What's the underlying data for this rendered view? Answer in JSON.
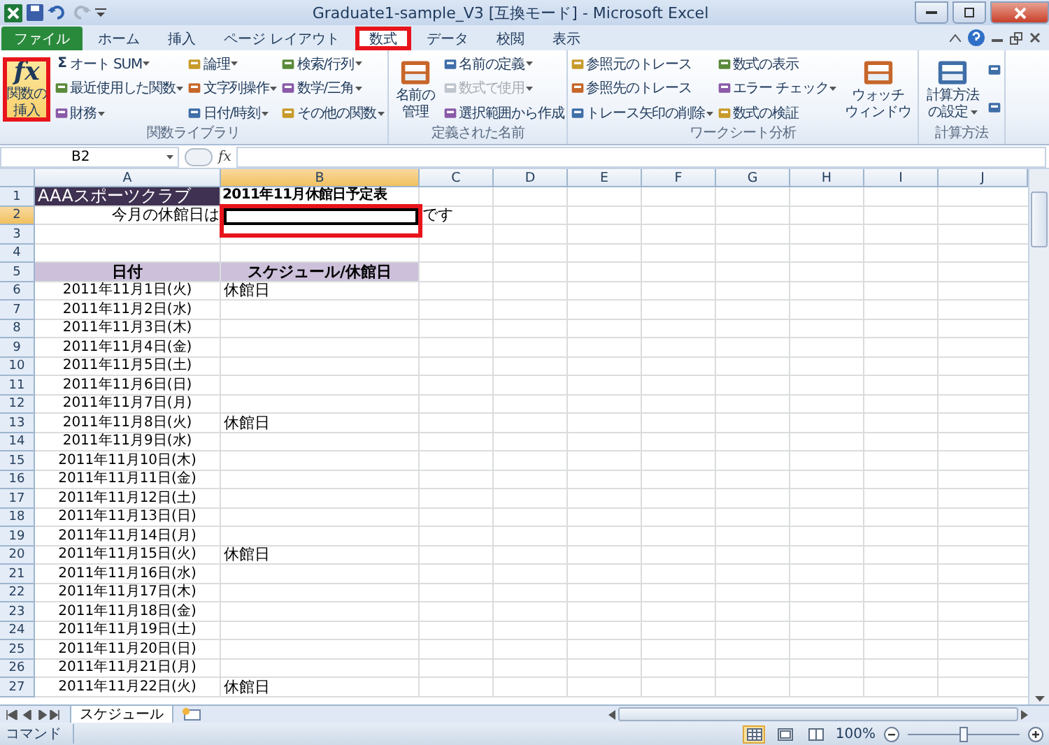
{
  "window": {
    "title": "Graduate1-sample_V3 [互換モード] - Microsoft Excel"
  },
  "tabs": [
    {
      "label": "ファイル",
      "kind": "file",
      "selected": false,
      "highlighted": false
    },
    {
      "label": "ホーム",
      "kind": "tab",
      "selected": false,
      "highlighted": false
    },
    {
      "label": "挿入",
      "kind": "tab",
      "selected": false,
      "highlighted": false
    },
    {
      "label": "ページ レイアウト",
      "kind": "tab",
      "selected": false,
      "highlighted": false
    },
    {
      "label": "数式",
      "kind": "tab",
      "selected": true,
      "highlighted": true
    },
    {
      "label": "データ",
      "kind": "tab",
      "selected": false,
      "highlighted": false
    },
    {
      "label": "校閲",
      "kind": "tab",
      "selected": false,
      "highlighted": false
    },
    {
      "label": "表示",
      "kind": "tab",
      "selected": false,
      "highlighted": false
    }
  ],
  "ribbon": {
    "groups": [
      {
        "label": "関数ライブラリ",
        "columns": [
          [
            {
              "kind": "large",
              "lines": [
                "関数の",
                "挿入"
              ],
              "glyph": "fx",
              "dropdown": false,
              "highlighted": true
            }
          ],
          [
            {
              "kind": "small",
              "label": "オート SUM",
              "glyph": "Σ",
              "dropdown": true,
              "disabled": false
            },
            {
              "kind": "small",
              "label": "最近使用した関数",
              "dropdown": true,
              "disabled": false
            },
            {
              "kind": "small",
              "label": "財務",
              "dropdown": true,
              "disabled": false
            }
          ],
          [
            {
              "kind": "small",
              "label": "論理",
              "dropdown": true,
              "disabled": false
            },
            {
              "kind": "small",
              "label": "文字列操作",
              "dropdown": true,
              "disabled": false
            },
            {
              "kind": "small",
              "label": "日付/時刻",
              "dropdown": true,
              "disabled": false
            }
          ],
          [
            {
              "kind": "small",
              "label": "検索/行列",
              "dropdown": true,
              "disabled": false
            },
            {
              "kind": "small",
              "label": "数学/三角",
              "dropdown": true,
              "disabled": false
            },
            {
              "kind": "small",
              "label": "その他の関数",
              "dropdown": true,
              "disabled": false
            }
          ]
        ]
      },
      {
        "label": "定義された名前",
        "columns": [
          [
            {
              "kind": "large",
              "lines": [
                "名前の",
                "管理"
              ],
              "dropdown": false,
              "highlighted": false
            }
          ],
          [
            {
              "kind": "small",
              "label": "名前の定義",
              "dropdown": true,
              "disabled": false
            },
            {
              "kind": "small",
              "label": "数式で使用",
              "dropdown": true,
              "disabled": true
            },
            {
              "kind": "small",
              "label": "選択範囲から作成",
              "dropdown": false,
              "disabled": false
            }
          ]
        ]
      },
      {
        "label": "ワークシート分析",
        "columns": [
          [
            {
              "kind": "small",
              "label": "参照元のトレース",
              "dropdown": false,
              "disabled": false
            },
            {
              "kind": "small",
              "label": "参照先のトレース",
              "dropdown": false,
              "disabled": false
            },
            {
              "kind": "small",
              "label": "トレース矢印の削除",
              "dropdown": true,
              "disabled": false
            }
          ],
          [
            {
              "kind": "small",
              "label": "数式の表示",
              "dropdown": false,
              "disabled": false
            },
            {
              "kind": "small",
              "label": "エラー チェック",
              "dropdown": true,
              "disabled": false
            },
            {
              "kind": "small",
              "label": "数式の検証",
              "dropdown": false,
              "disabled": false
            }
          ],
          [
            {
              "kind": "large",
              "lines": [
                "ウォッチ",
                "ウィンドウ"
              ],
              "dropdown": false,
              "highlighted": false
            }
          ]
        ]
      },
      {
        "label": "計算方法",
        "columns": [
          [
            {
              "kind": "large",
              "lines": [
                "計算方法",
                "の設定"
              ],
              "dropdown": true,
              "highlighted": false
            }
          ],
          [
            {
              "kind": "icon"
            },
            {
              "kind": "icon"
            }
          ]
        ]
      }
    ]
  },
  "formula_bar": {
    "name_box": "B2",
    "function_label": "fx"
  },
  "columns": [
    {
      "label": "A",
      "selected": false
    },
    {
      "label": "B",
      "selected": true
    },
    {
      "label": "C",
      "selected": false
    },
    {
      "label": "D",
      "selected": false
    },
    {
      "label": "E",
      "selected": false
    },
    {
      "label": "F",
      "selected": false
    },
    {
      "label": "G",
      "selected": false
    },
    {
      "label": "H",
      "selected": false
    },
    {
      "label": "I",
      "selected": false
    },
    {
      "label": "J",
      "selected": false
    }
  ],
  "rows": [
    {
      "header": "1",
      "selected": false,
      "cells": {
        "A": {
          "kind": "banner",
          "text": "AAAスポーツクラブ"
        },
        "B": {
          "kind": "title",
          "text": "2011年11月休館日予定表"
        }
      }
    },
    {
      "header": "2",
      "selected": true,
      "cells": {
        "A": {
          "kind": "label",
          "text": "今月の休館日は"
        },
        "B": {
          "kind": "input",
          "selected": true,
          "highlighted": true
        },
        "C": {
          "kind": "note",
          "text": "です"
        }
      }
    },
    {
      "header": "3",
      "selected": false
    },
    {
      "header": "4",
      "selected": false
    },
    {
      "header": "5",
      "selected": false,
      "cells": {
        "A": {
          "kind": "header",
          "text": "日付"
        },
        "B": {
          "kind": "header",
          "text": "スケジュール/休館日"
        }
      }
    },
    {
      "header": "6",
      "selected": false,
      "cells": {
        "A": {
          "kind": "date",
          "text": "2011年11月1日(火)"
        },
        "B": {
          "kind": "note",
          "text": "休館日"
        }
      }
    },
    {
      "header": "7",
      "selected": false,
      "cells": {
        "A": {
          "kind": "date",
          "text": "2011年11月2日(水)"
        }
      }
    },
    {
      "header": "8",
      "selected": false,
      "cells": {
        "A": {
          "kind": "date",
          "text": "2011年11月3日(木)"
        }
      }
    },
    {
      "header": "9",
      "selected": false,
      "cells": {
        "A": {
          "kind": "date",
          "text": "2011年11月4日(金)"
        }
      }
    },
    {
      "header": "10",
      "selected": false,
      "cells": {
        "A": {
          "kind": "date",
          "text": "2011年11月5日(土)"
        }
      }
    },
    {
      "header": "11",
      "selected": false,
      "cells": {
        "A": {
          "kind": "date",
          "text": "2011年11月6日(日)"
        }
      }
    },
    {
      "header": "12",
      "selected": false,
      "cells": {
        "A": {
          "kind": "date",
          "text": "2011年11月7日(月)"
        }
      }
    },
    {
      "header": "13",
      "selected": false,
      "cells": {
        "A": {
          "kind": "date",
          "text": "2011年11月8日(火)"
        },
        "B": {
          "kind": "note",
          "text": "休館日"
        }
      }
    },
    {
      "header": "14",
      "selected": false,
      "cells": {
        "A": {
          "kind": "date",
          "text": "2011年11月9日(水)"
        }
      }
    },
    {
      "header": "15",
      "selected": false,
      "cells": {
        "A": {
          "kind": "date",
          "text": "2011年11月10日(木)"
        }
      }
    },
    {
      "header": "16",
      "selected": false,
      "cells": {
        "A": {
          "kind": "date",
          "text": "2011年11月11日(金)"
        }
      }
    },
    {
      "header": "17",
      "selected": false,
      "cells": {
        "A": {
          "kind": "date",
          "text": "2011年11月12日(土)"
        }
      }
    },
    {
      "header": "18",
      "selected": false,
      "cells": {
        "A": {
          "kind": "date",
          "text": "2011年11月13日(日)"
        }
      }
    },
    {
      "header": "19",
      "selected": false,
      "cells": {
        "A": {
          "kind": "date",
          "text": "2011年11月14日(月)"
        }
      }
    },
    {
      "header": "20",
      "selected": false,
      "cells": {
        "A": {
          "kind": "date",
          "text": "2011年11月15日(火)"
        },
        "B": {
          "kind": "note",
          "text": "休館日"
        }
      }
    },
    {
      "header": "21",
      "selected": false,
      "cells": {
        "A": {
          "kind": "date",
          "text": "2011年11月16日(水)"
        }
      }
    },
    {
      "header": "22",
      "selected": false,
      "cells": {
        "A": {
          "kind": "date",
          "text": "2011年11月17日(木)"
        }
      }
    },
    {
      "header": "23",
      "selected": false,
      "cells": {
        "A": {
          "kind": "date",
          "text": "2011年11月18日(金)"
        }
      }
    },
    {
      "header": "24",
      "selected": false,
      "cells": {
        "A": {
          "kind": "date",
          "text": "2011年11月19日(土)"
        }
      }
    },
    {
      "header": "25",
      "selected": false,
      "cells": {
        "A": {
          "kind": "date",
          "text": "2011年11月20日(日)"
        }
      }
    },
    {
      "header": "26",
      "selected": false,
      "cells": {
        "A": {
          "kind": "date",
          "text": "2011年11月21日(月)"
        }
      }
    },
    {
      "header": "27",
      "selected": false,
      "cells": {
        "A": {
          "kind": "date",
          "text": "2011年11月22日(火)"
        },
        "B": {
          "kind": "note",
          "text": "休館日"
        }
      }
    }
  ],
  "sheet_tabs": [
    {
      "label": "スケジュール",
      "selected": true
    }
  ],
  "status_bar": {
    "mode": "コマンド",
    "views": [
      {
        "selected": true
      },
      {
        "selected": false
      },
      {
        "selected": false
      }
    ],
    "zoom": "100%",
    "zoom_slider": {
      "level": 0.5
    }
  }
}
